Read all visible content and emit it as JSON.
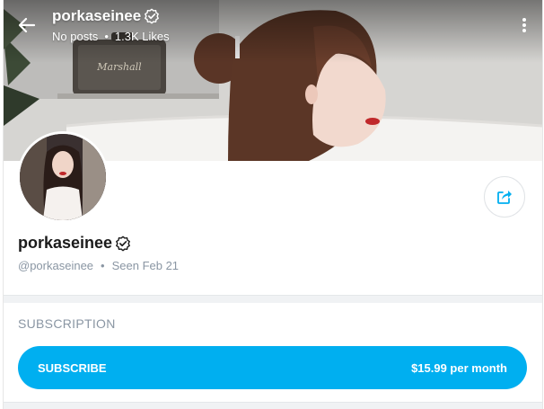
{
  "header": {
    "username": "porkaseinee",
    "posts": "No posts",
    "likes": "1.3K Likes"
  },
  "profile": {
    "display_name": "porkaseinee",
    "handle": "@porkaseinee",
    "last_seen": "Seen Feb 21"
  },
  "subscription": {
    "section_title": "SUBSCRIPTION",
    "button_label": "SUBSCRIBE",
    "price": "$15.99 per month"
  },
  "colors": {
    "accent": "#00aff0",
    "muted_text": "#8a96a3"
  },
  "icons": [
    "back-arrow-icon",
    "verified-badge-icon",
    "more-vertical-icon",
    "share-icon"
  ]
}
